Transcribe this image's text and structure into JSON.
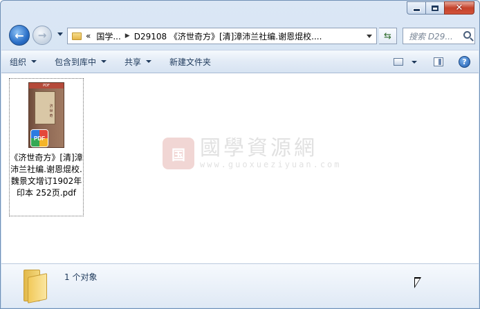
{
  "window": {
    "caption_buttons": [
      "minimize",
      "maximize",
      "close"
    ]
  },
  "navigation": {
    "back_icon": "back-arrow-icon",
    "forward_icon": "forward-arrow-icon",
    "breadcrumb_prefix": "«",
    "breadcrumb_root": "国学...",
    "breadcrumb_current": "D29108 《济世奇方》[清]漳沛兰社编.谢恩焜校....",
    "search_placeholder": "搜索 D29..."
  },
  "toolbar": {
    "organize": "组织",
    "include_in_library": "包含到库中",
    "share": "共享",
    "new_folder": "新建文件夹"
  },
  "files": [
    {
      "name": "《济世奇方》[清]漳沛兰社编.谢恩焜校.魏景文增订1902年印本 252页.pdf",
      "type_badge": "PDF",
      "thumb_top": "PDF"
    }
  ],
  "watermark": {
    "seal": "国",
    "title": "國學資源網",
    "url": "www.guoxueziyuan.com"
  },
  "details": {
    "count_text": "1 个对象"
  },
  "colors": {
    "accent": "#1e395b",
    "close_button": "#c4422b"
  }
}
